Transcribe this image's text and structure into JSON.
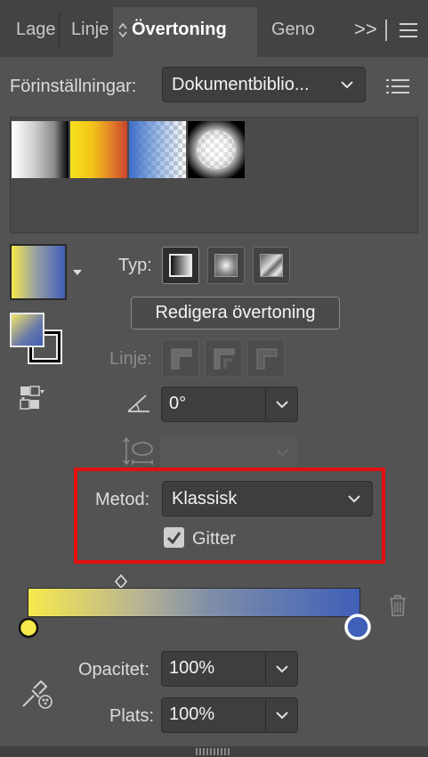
{
  "tabs": [
    {
      "label": "Lage",
      "active": false
    },
    {
      "label": "Linje",
      "active": false
    },
    {
      "label": "Övertoning",
      "active": true
    },
    {
      "label": "Geno",
      "active": false
    }
  ],
  "tabbar": {
    "overflow": ">>"
  },
  "presets": {
    "label": "Förinställningar:",
    "value": "Dokumentbiblio..."
  },
  "type": {
    "label": "Typ:"
  },
  "edit_gradient": {
    "label": "Redigera övertoning"
  },
  "stroke": {
    "label": "Linje:"
  },
  "angle": {
    "value": "0°"
  },
  "method": {
    "label": "Metod:",
    "value": "Klassisk"
  },
  "dither": {
    "label": "Gitter",
    "checked": true
  },
  "opacity": {
    "label": "Opacitet:",
    "value": "100%"
  },
  "location": {
    "label": "Plats:",
    "value": "100%"
  },
  "colors": {
    "gradient_start": "#f6e94c",
    "gradient_end": "#3f5fb8",
    "highlight": "#e41010"
  }
}
